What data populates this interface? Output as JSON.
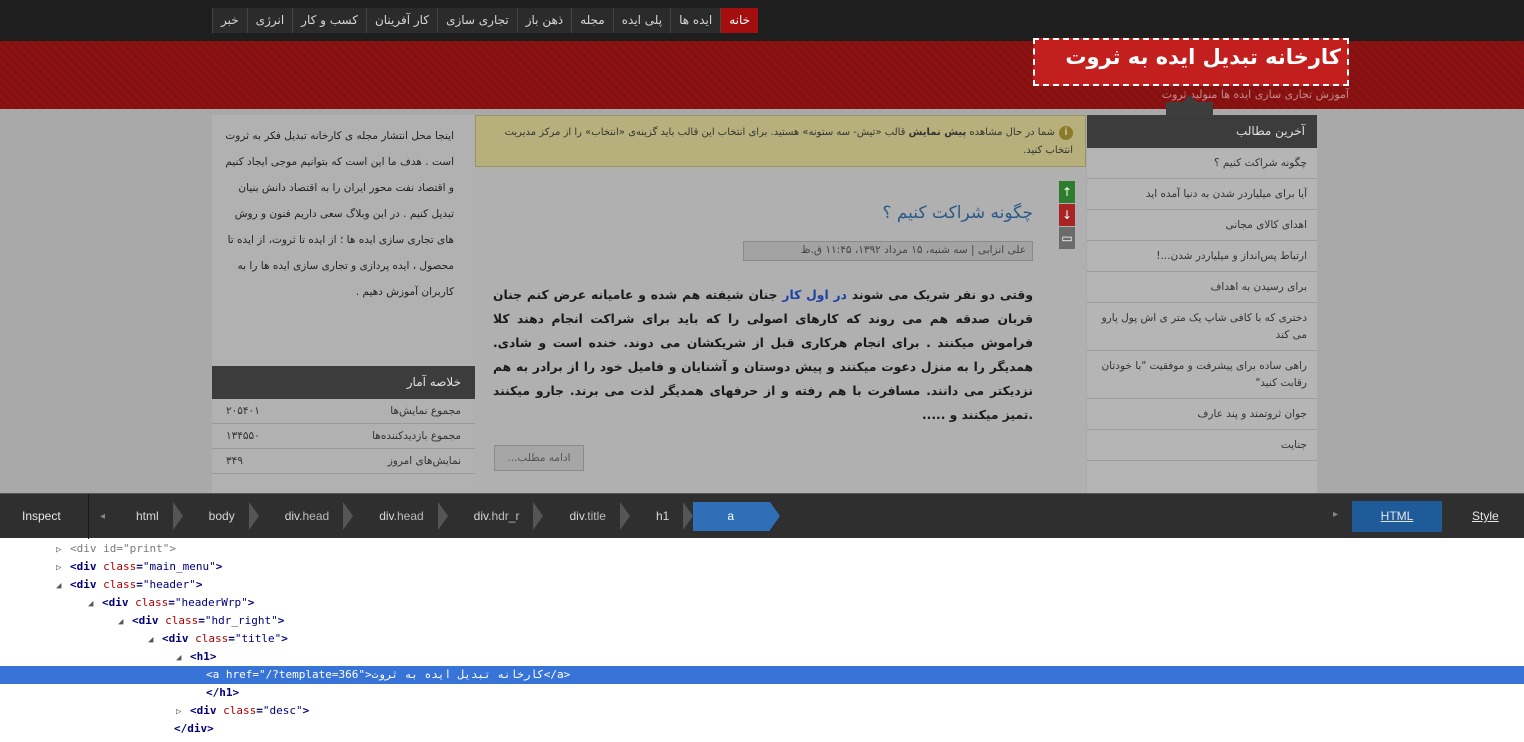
{
  "site": {
    "menu": [
      "خبر",
      "انرژی",
      "کسب و کار",
      "کار آفرینان",
      "تجاری سازی",
      "ذهن باز",
      "مجله",
      "پلی ایده",
      "ایده ها",
      "خانه"
    ],
    "title": "کارخانه تبدیل ایده به ثروت",
    "description": "آموزش تجاری سازی ایده ها منولید ثروت",
    "tooltip": "a",
    "notice": {
      "icon": "info-icon",
      "parts": [
        "شما در حال مشاهده ",
        "پیش نمایش",
        " قالب «تیش- سه ستونه» هستید. برای انتخاب این قالب باید گزینه‌ی «انتخاب» را از مرکز مدیریت انتخاب کنید."
      ]
    },
    "post": {
      "title": "چگونه شراکت کنیم ؟",
      "meta": "علی انزابی | سه شنبه، ۱۵ مرداد ۱۳۹۲، ۱۱:۴۵ ق.ظ",
      "body_before": "وقتی دو نفر شریک می شوند ",
      "body_highlight": "در اول کار",
      "body_after": " جنان شیفته هم شده و عامیانه عرض کنم جنان قربان صدقه هم می روند که کارهای اصولی را که باید برای شراکت انجام دهند کلا فراموش میکنند . برای انجام هرکاری قبل از شریکشان می دوند. خنده است و شادی. همدیگر را به منزل دعوت میکنند و پیش دوستان و آشنایان و فامیل خود را از برادر به هم نزدیکتر می دانند. مسافرت با هم رفته و از حرفهای همدیگر لذت می برند. جارو میکنند .تمیز میکنند و .....",
      "more": "ادامه مطلب..."
    },
    "share_icons": [
      "arrow-up-icon",
      "arrow-down-icon",
      "comment-icon"
    ],
    "recent": {
      "heading": "آخرین مطالب",
      "items": [
        "چگونه شراکت کنیم ؟",
        "آیا برای میلیاردر شدن به دنیا آمده اید",
        "اهدای کالای مجانی",
        "ارتباط پس‌انداز و میلیاردر شدن...!",
        "برای رسیدن به اهداف",
        "دختری که با کافی شاپ یک متر ی اش پول پارو می کند",
        "راهی ساده برای پیشرفت و موفقیت \"با خودتان رقابت کنید\"",
        "جوان ثروتمند و پند عارف",
        "جنایت"
      ]
    },
    "about": "اینجا محل انتشار مجله ی کارخانه تبدیل فکر به ثروت است . هدف ما این است که بتوانیم موجی ایجاد کنیم و اقتصاد نفت محور ایران را به اقتصاد دانش بنیان تبدیل کنیم . در این وبلاگ سعی داریم فنون و روش های تجاری سازی ایده ها ؛ از ایده تا ثروت، از ایده تا محصول ، ایده پردازی و تجاری سازی ایده ها را به کاربران آموزش دهیم .",
    "stats": {
      "heading": "خلاصه آمار",
      "rows": [
        {
          "label": "مجموع نمایش‌ها",
          "value": "۲۰۵۴۰۱"
        },
        {
          "label": "مجموع بازدیدکننده‌ها",
          "value": "۱۳۴۵۵۰"
        },
        {
          "label": "نمایش‌های امروز",
          "value": "۳۴۹"
        }
      ]
    }
  },
  "inspector": {
    "inspect_label": "Inspect",
    "breadcrumbs": [
      {
        "tag": "html",
        "cls": ""
      },
      {
        "tag": "body",
        "cls": ""
      },
      {
        "tag": "div",
        "cls": ".head"
      },
      {
        "tag": "div",
        "cls": ".head"
      },
      {
        "tag": "div",
        "cls": ".hdr_r"
      },
      {
        "tag": "div",
        "cls": ".title"
      },
      {
        "tag": "h1",
        "cls": ""
      },
      {
        "tag": "a",
        "cls": ""
      }
    ],
    "tab_html": "HTML",
    "tab_style": "Style",
    "tree": [
      {
        "indent": 56,
        "twisty": "▷",
        "open": "<div ",
        "attr": "id",
        "val": "\"print\"",
        "close": ">",
        "dim": true
      },
      {
        "indent": 56,
        "twisty": "▷",
        "open": "<div ",
        "attr": "class",
        "val": "\"main_menu\"",
        "close": ">",
        "dim": false
      },
      {
        "indent": 56,
        "twisty": "◢",
        "open": "<div ",
        "attr": "class",
        "val": "\"header\"",
        "close": ">",
        "dim": false
      },
      {
        "indent": 88,
        "twisty": "◢",
        "open": "<div ",
        "attr": "class",
        "val": "\"headerWrp\"",
        "close": ">",
        "dim": false
      },
      {
        "indent": 118,
        "twisty": "◢",
        "open": "<div ",
        "attr": "class",
        "val": "\"hdr_right\"",
        "close": ">",
        "dim": false
      },
      {
        "indent": 148,
        "twisty": "◢",
        "open": "<div ",
        "attr": "class",
        "val": "\"title\"",
        "close": ">",
        "dim": false
      },
      {
        "indent": 176,
        "twisty": "◢",
        "open": "<h1>",
        "attr": "",
        "val": "",
        "close": "",
        "dim": false
      },
      {
        "indent": 192,
        "twisty": "",
        "open": "<a ",
        "attr": "href",
        "val": "\"/?template=366\"",
        "close": ">کارخانه تبدیل ایده به ثروت</a>",
        "dim": false,
        "selected": true
      },
      {
        "indent": 192,
        "twisty": "",
        "open": "</h1>",
        "attr": "",
        "val": "",
        "close": "",
        "dim": false
      },
      {
        "indent": 176,
        "twisty": "▷",
        "open": "<div ",
        "attr": "class",
        "val": "\"desc\"",
        "close": ">",
        "dim": false
      },
      {
        "indent": 160,
        "twisty": "",
        "open": "</div>",
        "attr": "",
        "val": "",
        "close": "",
        "dim": false
      }
    ]
  }
}
